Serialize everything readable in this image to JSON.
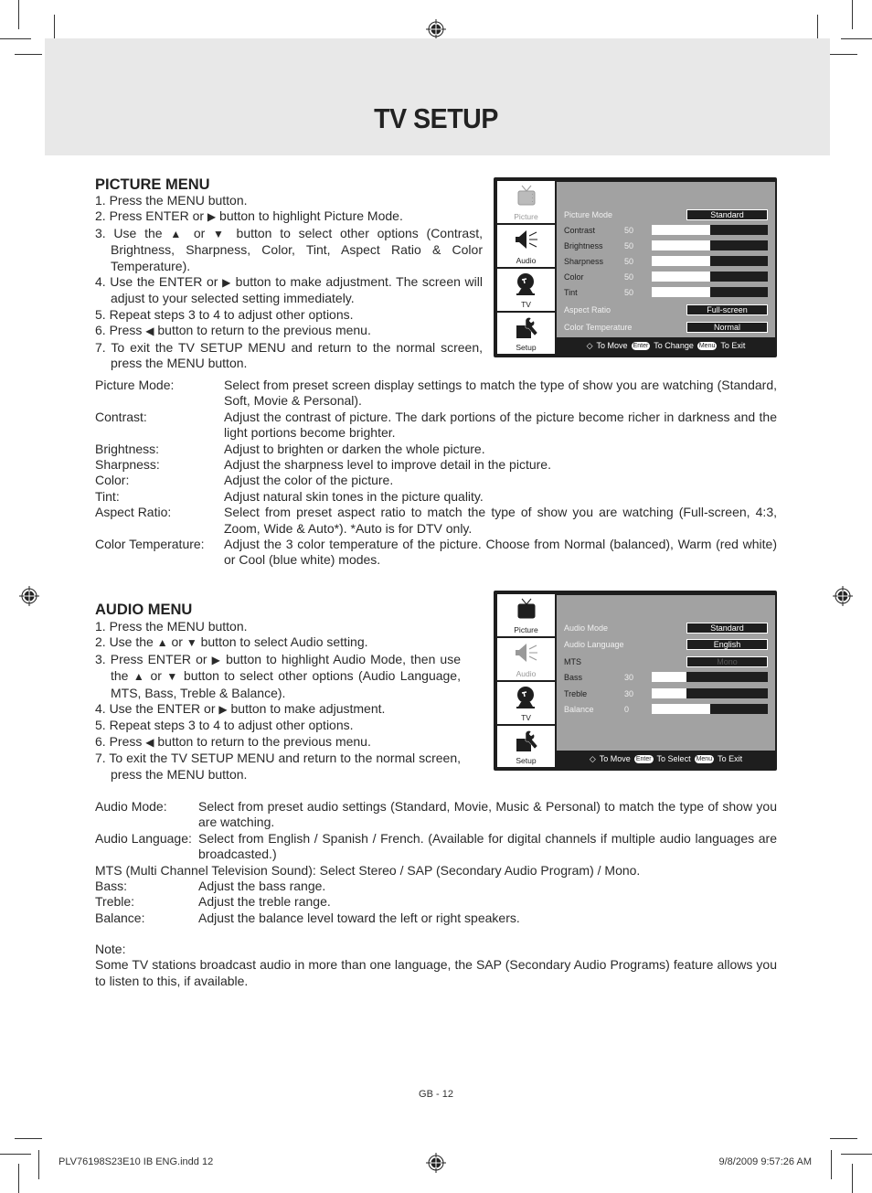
{
  "page": {
    "title": "TV SETUP",
    "page_number": "GB - 12",
    "slug_file": "PLV76198S23E10 IB ENG.indd   12",
    "slug_date": "9/8/2009   9:57:26 AM"
  },
  "picture_menu": {
    "heading": "PICTURE MENU",
    "steps": [
      {
        "pre": "1. Press the MENU button.",
        "post": ""
      },
      {
        "pre": "2. Press ENTER or ",
        "icon": "right-triangle",
        "post": " button to highlight Picture Mode."
      },
      {
        "pre": "3. Use the ",
        "icon": "up-triangle",
        "mid": " or ",
        "icon2": "down-triangle",
        "post": " button to select other options (Contrast, Brightness, Sharpness, Color, Tint, Aspect Ratio & Color Temperature)."
      },
      {
        "pre": "4. Use the ENTER or ",
        "icon": "right-triangle",
        "post": " button to make adjustment. The screen will adjust to your selected setting immediately."
      },
      {
        "pre": "5. Repeat steps 3 to 4 to adjust other options.",
        "post": ""
      },
      {
        "pre": "6. Press ",
        "icon": "left-triangle",
        "post": " button to return to the previous menu."
      },
      {
        "pre": "7. To exit the TV SETUP MENU and return to the normal screen, press the MENU button.",
        "post": ""
      }
    ],
    "definitions": [
      {
        "term": "Picture Mode:",
        "desc": "Select from preset screen display settings to match the type of show you are watching (Standard, Soft, Movie & Personal)."
      },
      {
        "term": "Contrast:",
        "desc": "Adjust the contrast of picture. The dark portions of the picture become richer in darkness and the light portions become brighter."
      },
      {
        "term": "Brightness:",
        "desc": "Adjust to brighten or darken the whole picture."
      },
      {
        "term": "Sharpness:",
        "desc": "Adjust the sharpness level to improve detail in the picture."
      },
      {
        "term": "Color:",
        "desc": "Adjust the color of the picture."
      },
      {
        "term": "Tint:",
        "desc": "Adjust natural skin tones in the picture quality."
      },
      {
        "term": "Aspect Ratio:",
        "desc": "Select from preset aspect ratio to match the type of show you are watching (Full-screen, 4:3, Zoom, Wide & Auto*). *Auto is for DTV only."
      },
      {
        "term": "Color Temperature:",
        "desc": "Adjust the 3 color temperature of the picture. Choose from Normal (balanced), Warm (red white) or Cool (blue white) modes."
      }
    ],
    "osd": {
      "tabs": [
        "Picture",
        "Audio",
        "TV",
        "Setup"
      ],
      "active_tab": "Picture",
      "rows": [
        {
          "label": "Picture Mode",
          "value": "Standard"
        },
        {
          "label": "Contrast",
          "number": "50",
          "level": 0.5
        },
        {
          "label": "Brightness",
          "number": "50",
          "level": 0.5
        },
        {
          "label": "Sharpness",
          "number": "50",
          "level": 0.5
        },
        {
          "label": "Color",
          "number": "50",
          "level": 0.5
        },
        {
          "label": "Tint",
          "number": "50",
          "level": 0.5
        },
        {
          "label": "Aspect Ratio",
          "value": "Full-screen"
        },
        {
          "label": "Color Temperature",
          "value": "Normal"
        }
      ],
      "footer": {
        "move": "To Move",
        "enter_key": "Enter",
        "action": "To Change",
        "menu_key": "Menu",
        "exit": "To Exit"
      }
    }
  },
  "audio_menu": {
    "heading": "AUDIO MENU",
    "steps": [
      {
        "pre": "1. Press the MENU button.",
        "post": ""
      },
      {
        "pre": "2. Use the ",
        "icon": "up-triangle",
        "mid": " or ",
        "icon2": "down-triangle",
        "post": " button to select Audio setting."
      },
      {
        "pre": "3. Press ENTER or ",
        "icon": "right-triangle",
        "post": " button to highlight Audio Mode, then use the ",
        "icon3": "up-triangle",
        "mid2": " or ",
        "icon4": "down-triangle",
        "post2": " button to select other options (Audio Language, MTS, Bass, Treble & Balance)."
      },
      {
        "pre": "4. Use the ENTER or ",
        "icon": "right-triangle",
        "post": " button to make adjustment."
      },
      {
        "pre": "5. Repeat steps 3 to 4 to adjust other options.",
        "post": ""
      },
      {
        "pre": "6. Press ",
        "icon": "left-triangle",
        "post": " button to return to the previous menu."
      },
      {
        "pre": "7. To exit the TV SETUP MENU and return to the normal screen, press the MENU button.",
        "post": ""
      }
    ],
    "definitions": [
      {
        "term": "Audio Mode:",
        "desc": "Select from preset audio settings (Standard, Movie, Music & Personal) to match the type of show you are watching."
      },
      {
        "term": "Audio Language:",
        "desc": "Select from English / Spanish / French. (Available for digital channels if multiple audio languages are broadcasted.)"
      },
      {
        "full": "MTS (Multi Channel Television Sound): Select Stereo / SAP (Secondary Audio Program) / Mono."
      },
      {
        "term": "Bass:",
        "desc": "Adjust the bass range."
      },
      {
        "term": "Treble:",
        "desc": "Adjust the treble range."
      },
      {
        "term": "Balance:",
        "desc": "Adjust the balance level toward the left or right speakers."
      }
    ],
    "note_label": "Note:",
    "note_text": "Some TV stations broadcast audio in more than one language, the SAP (Secondary Audio Programs) feature allows you to listen to this, if available.",
    "osd": {
      "tabs": [
        "Picture",
        "Audio",
        "TV",
        "Setup"
      ],
      "active_tab": "Audio",
      "rows": [
        {
          "label": "Audio Mode",
          "value": "Standard"
        },
        {
          "label": "Audio Language",
          "value": "English"
        },
        {
          "label": "MTS",
          "value": "Mono",
          "disabled": true
        },
        {
          "label": "Bass",
          "number": "30",
          "level": 0.3
        },
        {
          "label": "Treble",
          "number": "30",
          "level": 0.3
        },
        {
          "label": "Balance",
          "number": "0",
          "level": 0.5
        }
      ],
      "footer": {
        "move": "To Move",
        "enter_key": "Enter",
        "action": "To Select",
        "menu_key": "Menu",
        "exit": "To Exit"
      }
    }
  }
}
